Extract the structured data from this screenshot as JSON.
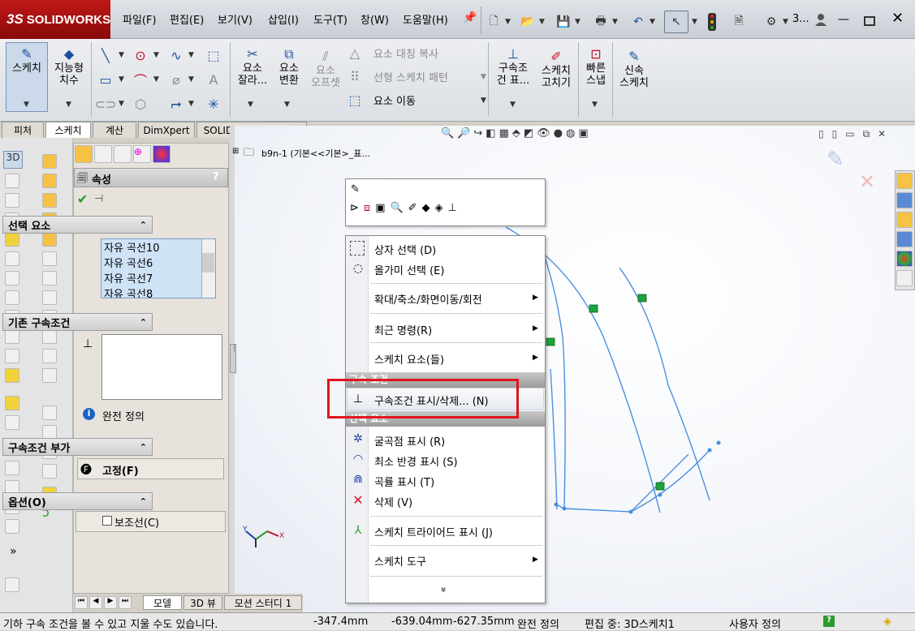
{
  "app": {
    "logo_text": "SOLIDWORKS",
    "logo_prefix": "3S"
  },
  "menu": [
    "파일(F)",
    "편집(E)",
    "보기(V)",
    "삽입(I)",
    "도구(T)",
    "창(W)",
    "도움말(H)"
  ],
  "titlebar_text": "3...",
  "ribbon": {
    "sketch": "스케치",
    "smart_dim_1": "지능형",
    "smart_dim_2": "치수",
    "trim_1": "요소",
    "trim_2": "잘라...",
    "convert_1": "요소",
    "convert_2": "변환",
    "offset_1": "요소",
    "offset_2": "오프셋",
    "mirror": "요소 대칭 복사",
    "linear_pattern": "선형 스케치 패턴",
    "move": "요소 이동",
    "relations_1": "구속조",
    "relations_2": "건 표...",
    "repair_1": "스케치",
    "repair_2": "고치기",
    "quick_snap_1": "빠른",
    "quick_snap_2": "스냅",
    "rapid_sketch_1": "신속",
    "rapid_sketch_2": "스케치"
  },
  "tabs": [
    "피처",
    "스케치",
    "계산",
    "DimXpert",
    "SOLIDWORKS 애드인"
  ],
  "tree": {
    "root": "b9n-1  (기본<<기본>_표..."
  },
  "pm": {
    "title": "속성",
    "help": "?",
    "selected_header": "선택 요소",
    "selected_items": [
      "자유 곡선10",
      "자유 곡선6",
      "자유 곡선7",
      "자유 곡선8"
    ],
    "existing_header": "기존 구속조건",
    "status": "완전 정의",
    "add_header": "구속조건 부가",
    "fix_label": "고정(F)",
    "options_header": "옵션(O)",
    "construction_label": "보조선(C)"
  },
  "ctx": {
    "items": [
      {
        "label": "상자 선택 (D)",
        "icon": "box-select-icon"
      },
      {
        "label": "올가미 선택 (E)",
        "icon": "lasso-icon"
      },
      {
        "label": "확대/축소/화면이동/회전",
        "icon": ""
      },
      {
        "label": "최근 명령(R)",
        "icon": ""
      },
      {
        "label": "스케치 요소(들)",
        "icon": ""
      },
      {
        "label": "구속조건 표시/삭제... (N)",
        "icon": "relations-icon"
      },
      {
        "label": "굴곡점 표시 (R)",
        "icon": "inflection-icon"
      },
      {
        "label": "최소 반경 표시 (S)",
        "icon": "min-radius-icon"
      },
      {
        "label": "곡률 표시 (T)",
        "icon": "curvature-icon"
      },
      {
        "label": "삭제 (V)",
        "icon": "delete-icon"
      },
      {
        "label": "스케치 트라이어드 표시 (J)",
        "icon": "triad-icon"
      },
      {
        "label": "스케치 도구",
        "icon": ""
      }
    ],
    "group_relations": "구속 조건",
    "group_selection": "선택 요소",
    "more": "»"
  },
  "bottom_tabs": [
    "모델",
    "3D 뷰",
    "모션 스터디 1"
  ],
  "status": {
    "message": "기하 구속 조건을 볼 수 있고 지울 수도 있습니다.",
    "x": "-347.4mm",
    "y": "-639.04mm",
    "z": "-627.35mm",
    "defined": "완전 정의",
    "editing": "편집 중: 3D스케치1",
    "units": "사용자 정의"
  },
  "colors": {
    "highlight": "#e0141e",
    "curve": "#4a90e2",
    "marker": "#1aa53a"
  }
}
